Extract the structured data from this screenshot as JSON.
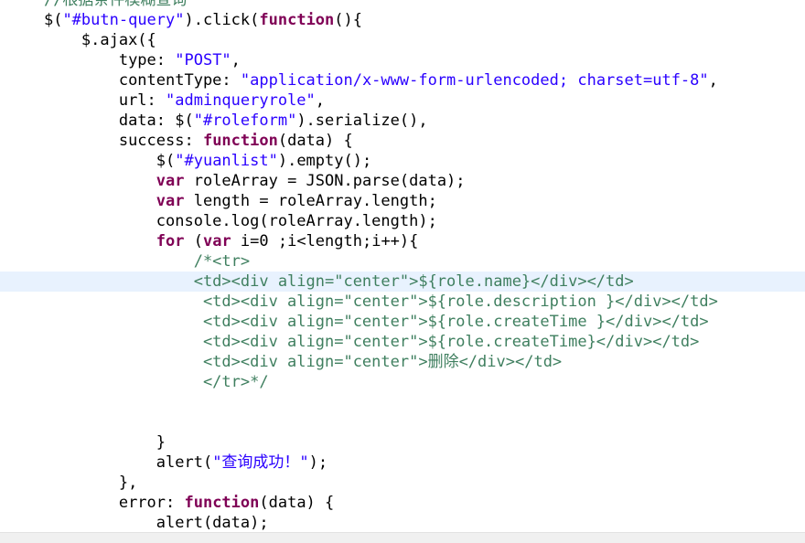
{
  "editor": {
    "colors": {
      "keyword": "#7f0055",
      "string": "#2a00ff",
      "comment": "#3f7f5f",
      "text": "#000000",
      "current_line": "#e8f2fe"
    },
    "lines": [
      {
        "indent": "    ",
        "segments": [
          {
            "t": "com",
            "v": "//根据条件模糊查询"
          }
        ]
      },
      {
        "indent": "    ",
        "segments": [
          {
            "t": "txt",
            "v": "$("
          },
          {
            "t": "str",
            "v": "\"#butn-query\""
          },
          {
            "t": "txt",
            "v": ").click("
          },
          {
            "t": "kw",
            "v": "function"
          },
          {
            "t": "txt",
            "v": "(){"
          }
        ]
      },
      {
        "indent": "        ",
        "segments": [
          {
            "t": "txt",
            "v": "$.ajax({"
          }
        ]
      },
      {
        "indent": "            ",
        "segments": [
          {
            "t": "txt",
            "v": "type: "
          },
          {
            "t": "str",
            "v": "\"POST\""
          },
          {
            "t": "txt",
            "v": ","
          }
        ]
      },
      {
        "indent": "            ",
        "segments": [
          {
            "t": "txt",
            "v": "contentType: "
          },
          {
            "t": "str",
            "v": "\"application/x-www-form-urlencoded; charset=utf-8\""
          },
          {
            "t": "txt",
            "v": ","
          }
        ]
      },
      {
        "indent": "            ",
        "segments": [
          {
            "t": "txt",
            "v": "url: "
          },
          {
            "t": "str",
            "v": "\"adminqueryrole\""
          },
          {
            "t": "txt",
            "v": ","
          }
        ]
      },
      {
        "indent": "            ",
        "segments": [
          {
            "t": "txt",
            "v": "data: $("
          },
          {
            "t": "str",
            "v": "\"#roleform\""
          },
          {
            "t": "txt",
            "v": ").serialize(),"
          }
        ]
      },
      {
        "indent": "            ",
        "segments": [
          {
            "t": "txt",
            "v": "success: "
          },
          {
            "t": "kw",
            "v": "function"
          },
          {
            "t": "txt",
            "v": "(data) {"
          }
        ]
      },
      {
        "indent": "                ",
        "segments": [
          {
            "t": "txt",
            "v": "$("
          },
          {
            "t": "str",
            "v": "\"#yuanlist\""
          },
          {
            "t": "txt",
            "v": ").empty();"
          }
        ]
      },
      {
        "indent": "                ",
        "segments": [
          {
            "t": "kw",
            "v": "var"
          },
          {
            "t": "txt",
            "v": " roleArray = JSON.parse(data);"
          }
        ]
      },
      {
        "indent": "                ",
        "segments": [
          {
            "t": "kw",
            "v": "var"
          },
          {
            "t": "txt",
            "v": " length = roleArray.length;"
          }
        ]
      },
      {
        "indent": "                ",
        "segments": [
          {
            "t": "txt",
            "v": "console.log(roleArray.length);"
          }
        ]
      },
      {
        "indent": "                ",
        "segments": [
          {
            "t": "kw",
            "v": "for"
          },
          {
            "t": "txt",
            "v": " ("
          },
          {
            "t": "kw",
            "v": "var"
          },
          {
            "t": "txt",
            "v": " i=0 ;i<length;i++){"
          }
        ]
      },
      {
        "indent": "                    ",
        "segments": [
          {
            "t": "com",
            "v": "/*<tr>"
          }
        ]
      },
      {
        "indent": "                    ",
        "current": true,
        "segments": [
          {
            "t": "com",
            "v": "<td><div align=\"center\">${role.name}</div></td>"
          }
        ]
      },
      {
        "indent": "                     ",
        "segments": [
          {
            "t": "com",
            "v": "<td><div align=\"center\">${role.description }</div></td>"
          }
        ]
      },
      {
        "indent": "                     ",
        "segments": [
          {
            "t": "com",
            "v": "<td><div align=\"center\">${role.createTime }</div></td>"
          }
        ]
      },
      {
        "indent": "                     ",
        "segments": [
          {
            "t": "com",
            "v": "<td><div align=\"center\">${role.createTime}</div></td>"
          }
        ]
      },
      {
        "indent": "                     ",
        "segments": [
          {
            "t": "com",
            "v": "<td><div align=\"center\">删除</div></td>"
          }
        ]
      },
      {
        "indent": "                     ",
        "segments": [
          {
            "t": "com",
            "v": "</tr>*/"
          }
        ]
      },
      {
        "indent": "",
        "segments": []
      },
      {
        "indent": "",
        "segments": []
      },
      {
        "indent": "                ",
        "segments": [
          {
            "t": "txt",
            "v": "}"
          }
        ]
      },
      {
        "indent": "                ",
        "segments": [
          {
            "t": "txt",
            "v": "alert("
          },
          {
            "t": "str",
            "v": "\"查询成功！\""
          },
          {
            "t": "txt",
            "v": ");"
          }
        ]
      },
      {
        "indent": "            ",
        "segments": [
          {
            "t": "txt",
            "v": "},"
          }
        ]
      },
      {
        "indent": "            ",
        "segments": [
          {
            "t": "txt",
            "v": "error: "
          },
          {
            "t": "kw",
            "v": "function"
          },
          {
            "t": "txt",
            "v": "(data) {"
          }
        ]
      },
      {
        "indent": "                ",
        "segments": [
          {
            "t": "txt",
            "v": "alert(data);"
          }
        ]
      }
    ]
  }
}
